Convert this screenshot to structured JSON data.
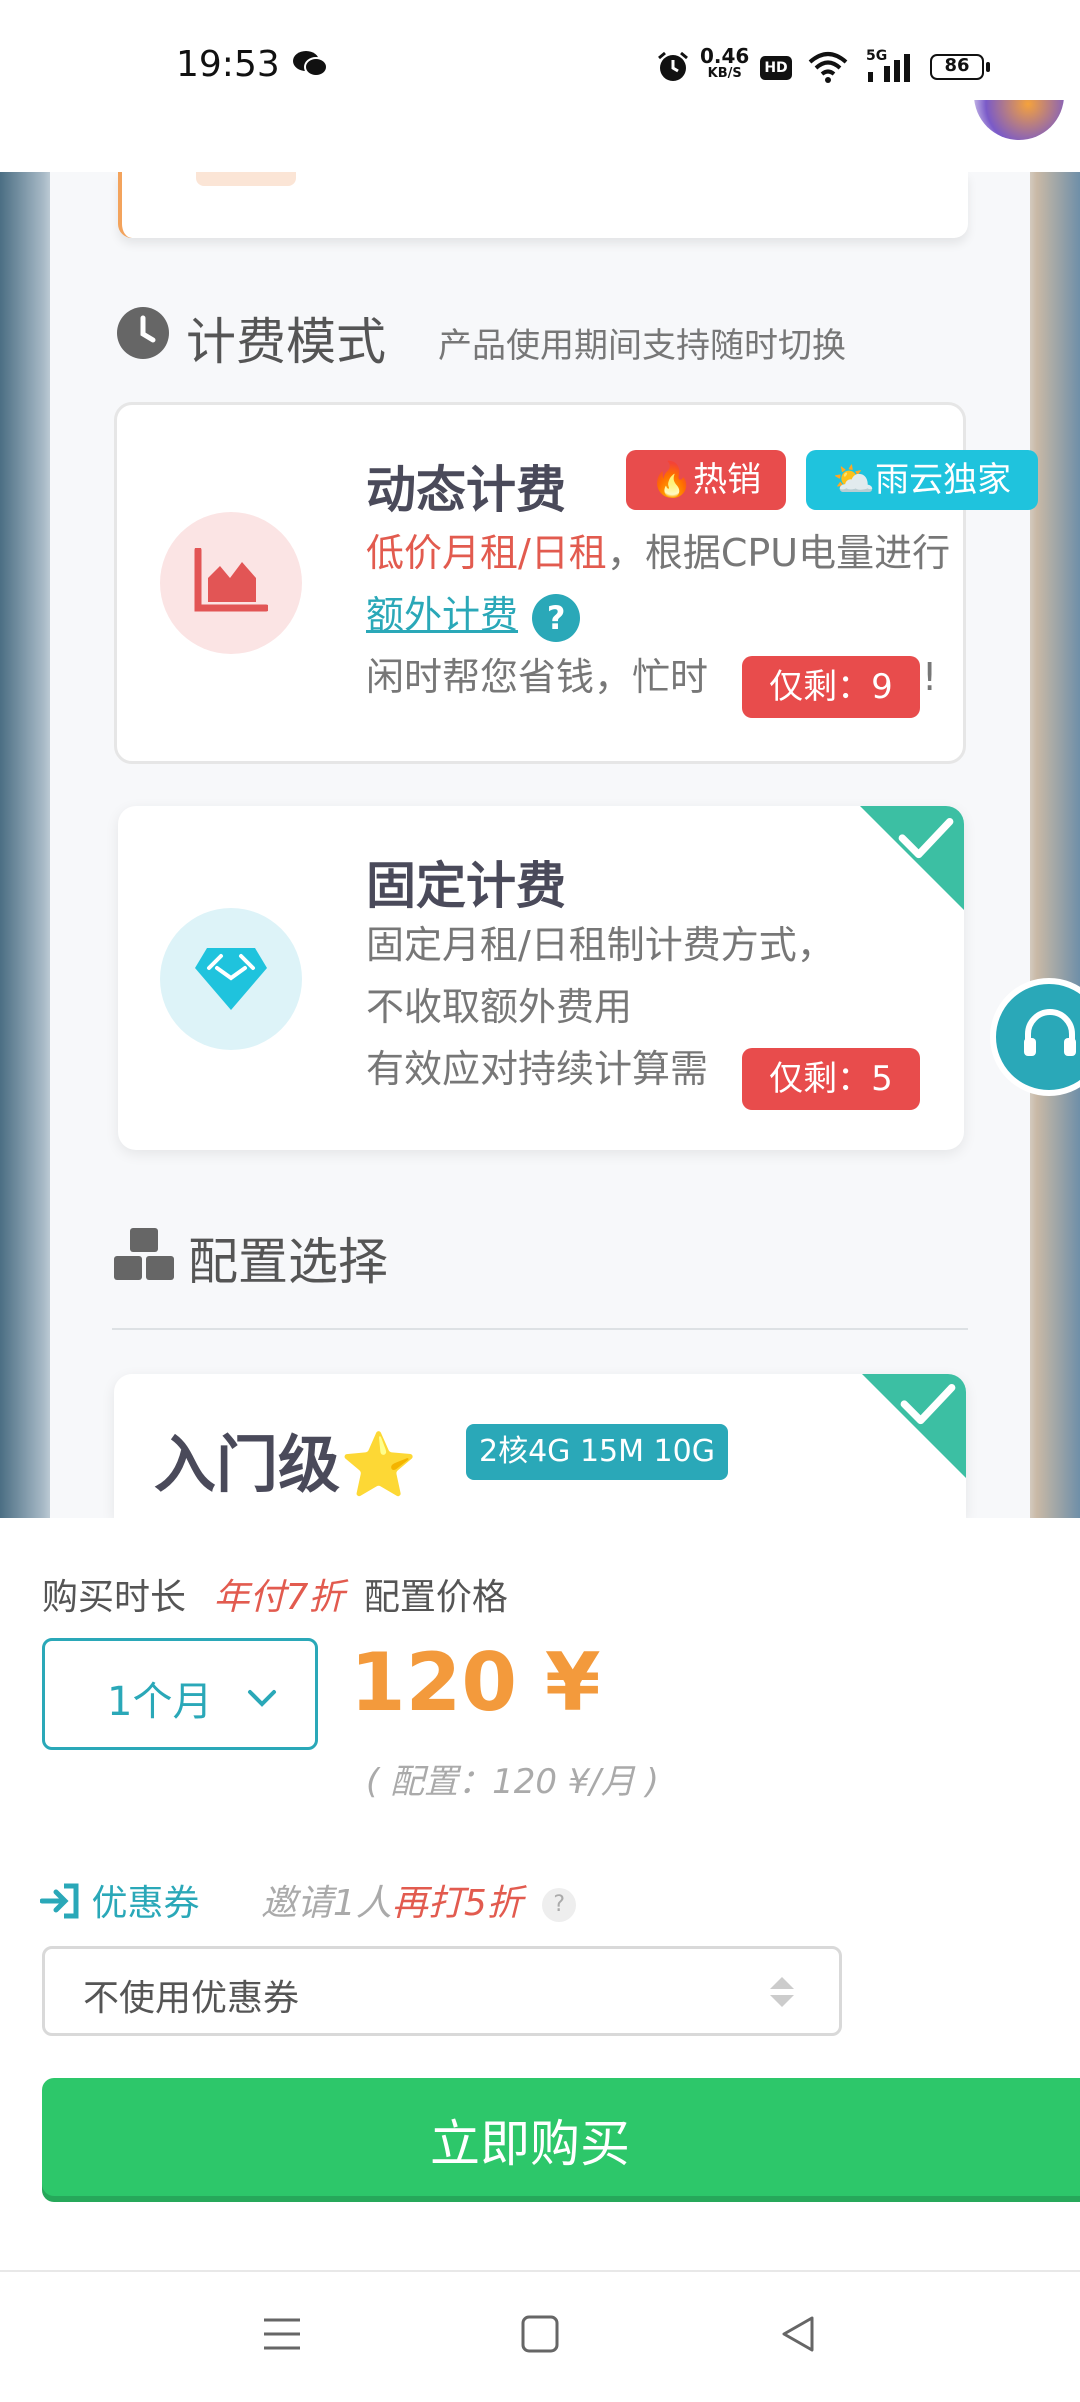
{
  "status_bar": {
    "time": "19:53",
    "net_speed_value": "0.46",
    "net_speed_unit": "KB/S",
    "hd_label": "HD",
    "network_type": "5G",
    "battery": "86"
  },
  "billing": {
    "title": "计费模式",
    "subtitle": "产品使用期间支持随时切换",
    "dynamic": {
      "title": "动态计费",
      "badge_hot": "🔥热销",
      "badge_exclusive": "⛅雨云独家",
      "desc_highlight": "低价月租/日租",
      "desc_rest": "，根据CPU电量进行",
      "desc_link": "额外计费",
      "help": "?",
      "desc_line3": "闲时帮您省钱，忙时",
      "desc_line3_end": "!",
      "remaining": "仅剩：9"
    },
    "fixed": {
      "title": "固定计费",
      "desc_line1": "固定月租/日租制计费方式，",
      "desc_line2": "不收取额外费用",
      "desc_line3": "有效应对持续计算需",
      "remaining": "仅剩：5"
    }
  },
  "config": {
    "title": "配置选择",
    "tier_name": "入门级",
    "tier_star": "⭐",
    "tier_spec": "2核4G 15M 10G"
  },
  "purchase": {
    "duration_label": "购买时长",
    "annual_discount": "年付7折",
    "price_label": "配置价格",
    "duration_value": "1个月",
    "price": "120 ¥",
    "price_detail": "( 配置：120 ¥/月 )",
    "coupon_label": "优惠券",
    "invite_text": "邀请1人",
    "invite_discount": "再打5折",
    "invite_help": "?",
    "coupon_select": "不使用优惠券",
    "buy_button": "立即购买"
  },
  "colors": {
    "accent_teal": "#2aa8b8",
    "buy_green": "#2dc76a",
    "price_orange": "#f39a3c",
    "discount_red": "#e25b4f",
    "remain_red": "#e84c4c"
  }
}
